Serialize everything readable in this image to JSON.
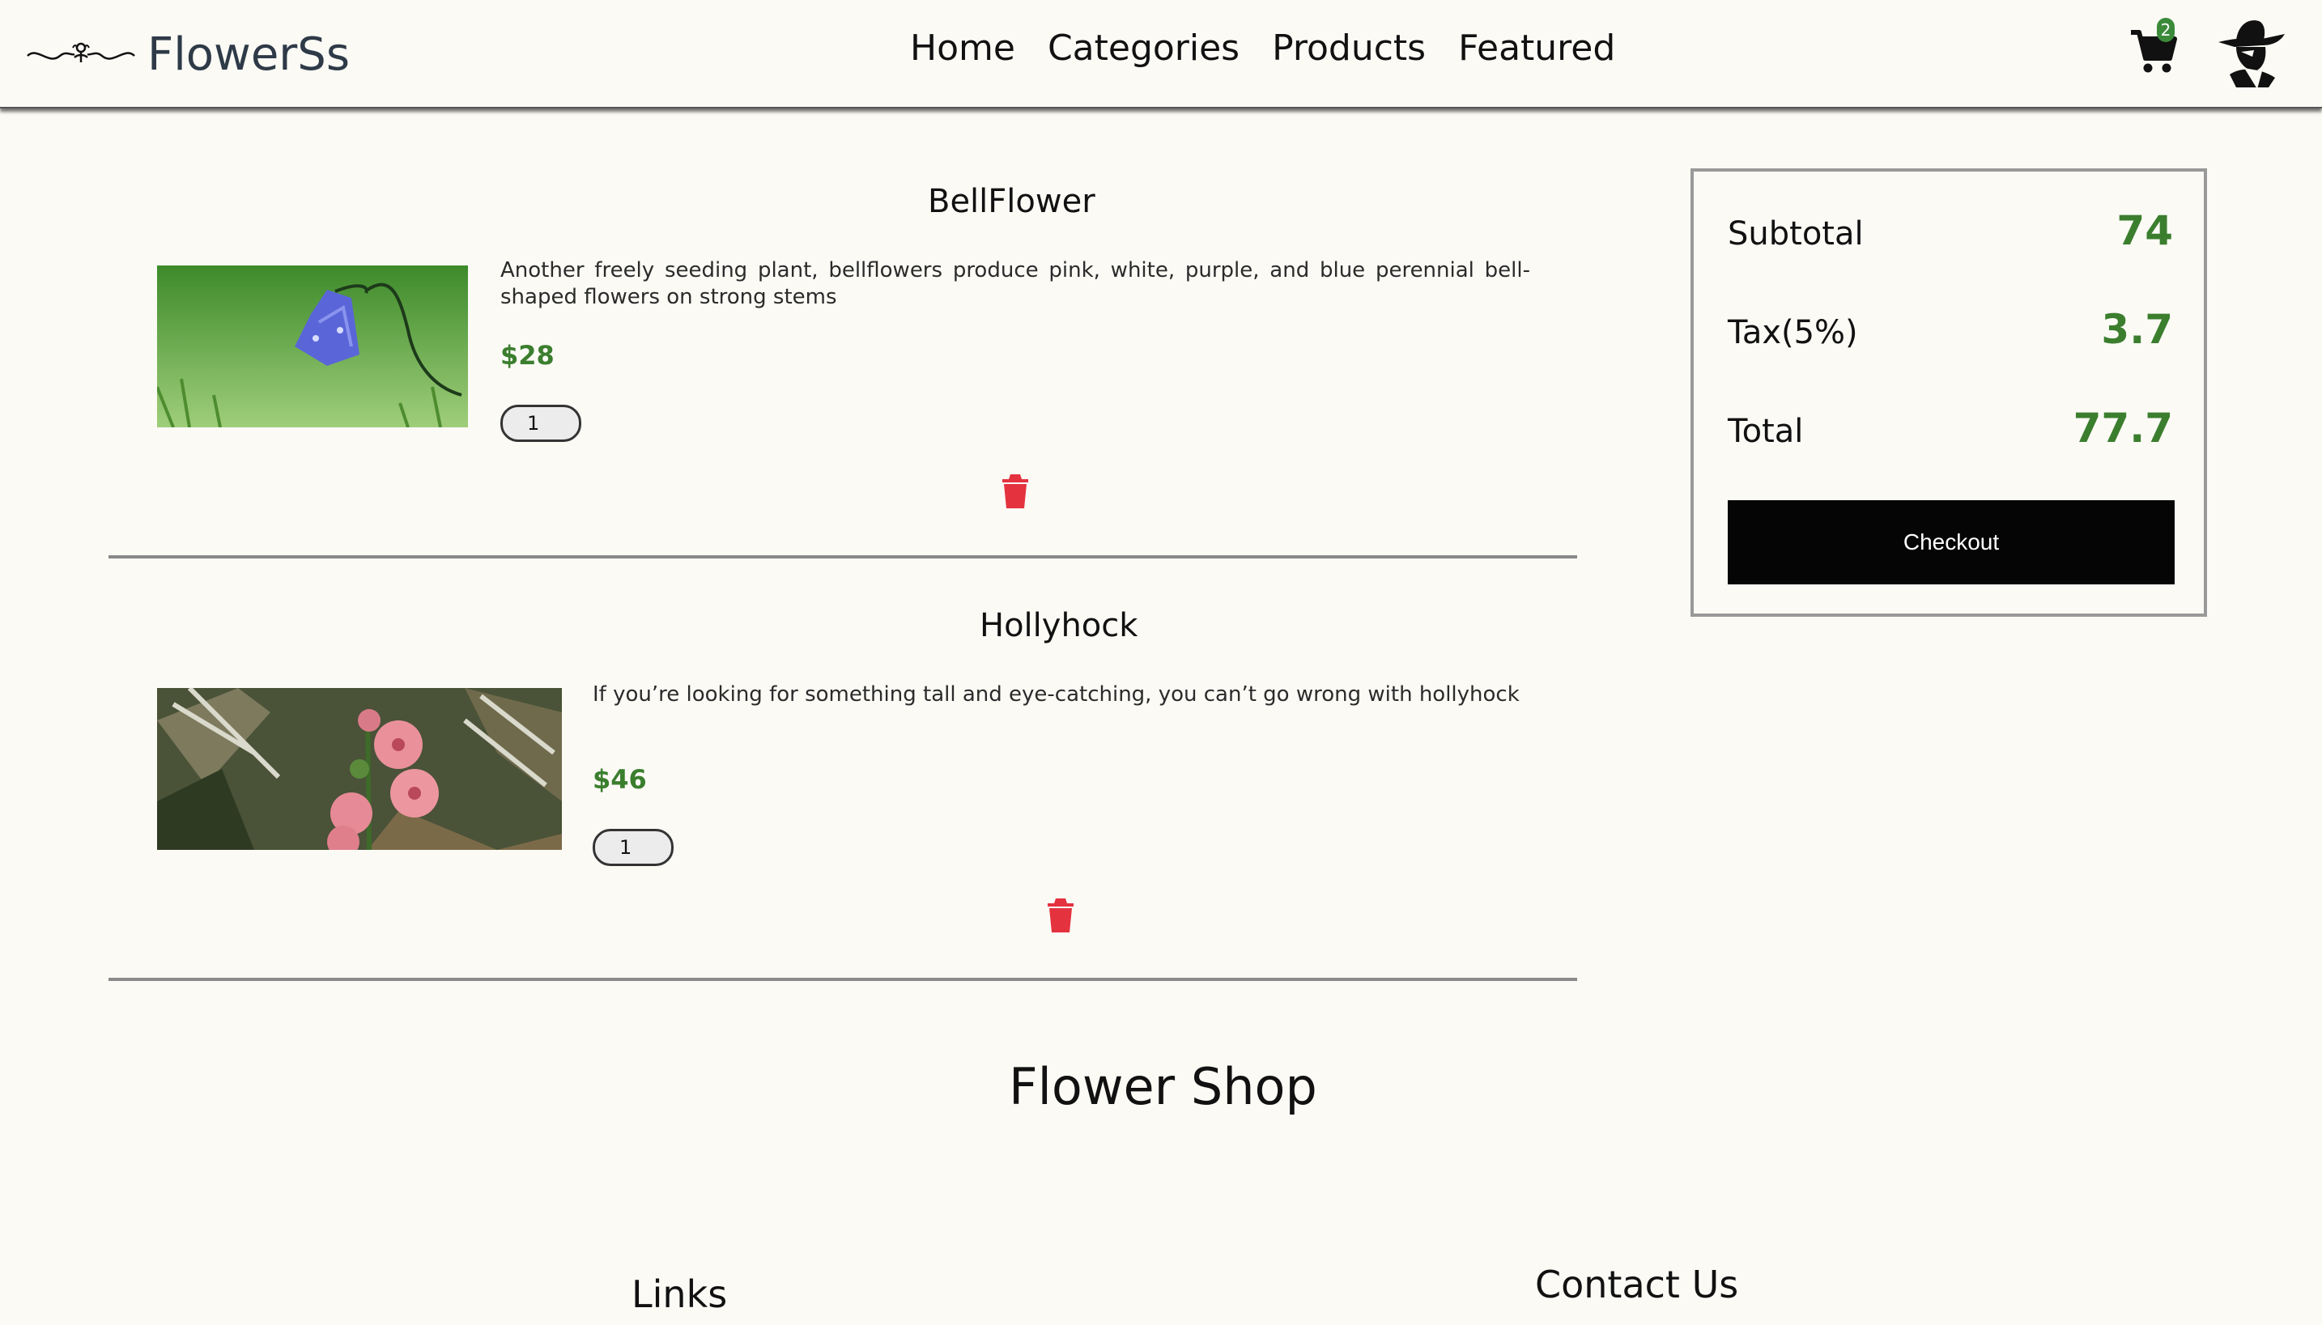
{
  "brand": {
    "name": "FlowerSs"
  },
  "nav": {
    "items": [
      "Home",
      "Categories",
      "Products",
      "Featured"
    ]
  },
  "cart": {
    "count": "2"
  },
  "items": [
    {
      "title": "BellFlower",
      "description": "Another freely seeding plant, bellflowers produce pink, white, purple, and blue perennial bell-shaped flowers on strong stems",
      "price": "$28",
      "quantity": "1"
    },
    {
      "title": "Hollyhock",
      "description": "If you’re looking for something tall and eye-catching, you can’t go wrong with hollyhock",
      "price": "$46",
      "quantity": "1"
    }
  ],
  "summary": {
    "subtotal_label": "Subtotal",
    "subtotal_value": "74",
    "tax_label": "Tax(5%)",
    "tax_value": "3.7",
    "total_label": "Total",
    "total_value": "77.7",
    "checkout_label": "Checkout"
  },
  "footer": {
    "title": "Flower Shop",
    "links_heading": "Links",
    "contact_heading": "Contact Us"
  },
  "colors": {
    "accent_green": "#3b7e2e",
    "delete_red": "#e5323f",
    "button_black": "#050505"
  },
  "icons": {
    "cart": "shopping-cart-icon",
    "delete": "trash-icon",
    "avatar": "user-avatar-icon"
  }
}
